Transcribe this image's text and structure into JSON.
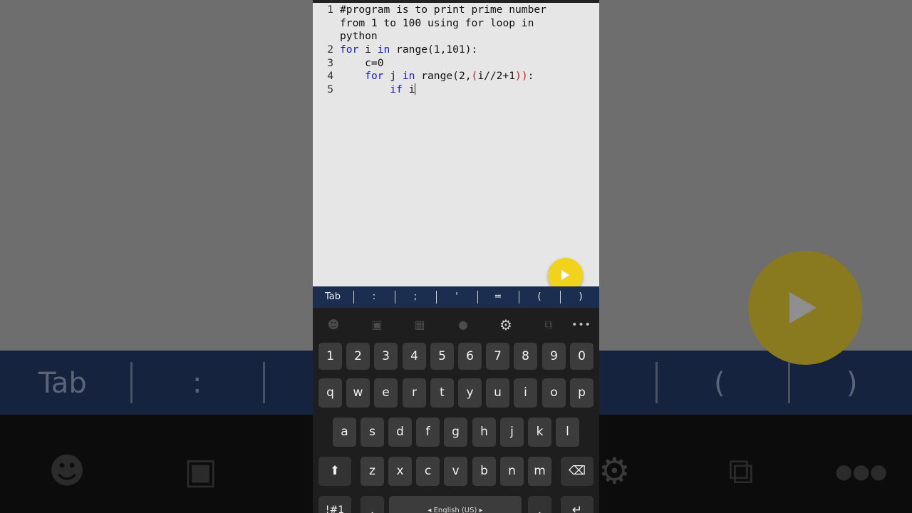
{
  "editor": {
    "lines": [
      {
        "n": "1",
        "text1": "#program is to print prime number",
        "text2": "from 1 to 100 using for loop in",
        "text3": "python"
      },
      {
        "n": "2",
        "kw": "for",
        "a": " i ",
        "kw2": "in",
        "b": " range(1,101):"
      },
      {
        "n": "3",
        "text": "    c=0"
      },
      {
        "n": "4",
        "indent": "    ",
        "kw": "for",
        "a": " j ",
        "kw2": "in",
        "b": " range(2,",
        "p1": "(",
        "c": "i//2+1",
        "p2": "))",
        "d": ":"
      },
      {
        "n": "5",
        "indent": "        ",
        "kw": "if",
        "a": " i"
      }
    ]
  },
  "symbols": [
    "Tab",
    ":",
    ";",
    "'",
    "=",
    "(",
    ")"
  ],
  "keyboard": {
    "numbers": [
      "1",
      "2",
      "3",
      "4",
      "5",
      "6",
      "7",
      "8",
      "9",
      "0"
    ],
    "row1": [
      "q",
      "w",
      "e",
      "r",
      "t",
      "y",
      "u",
      "i",
      "o",
      "p"
    ],
    "row2": [
      "a",
      "s",
      "d",
      "f",
      "g",
      "h",
      "j",
      "k",
      "l"
    ],
    "row3": [
      "z",
      "x",
      "c",
      "v",
      "b",
      "n",
      "m"
    ],
    "symbols_key": "!#1",
    "comma": ",",
    "period": ".",
    "space_label": "English (US)",
    "toolbar_more": "•••"
  },
  "background": {
    "tab": "Tab",
    "colon": ":",
    "lparen": "(",
    "rparen": ")"
  },
  "colors": {
    "editor_bg": "#e6e6e6",
    "keyword": "#1a1ad0",
    "paren": "#c81e1e",
    "symbol_bar": "#1c2e50",
    "run_button": "#f2d31c",
    "key_bg": "#3c3c3c"
  }
}
